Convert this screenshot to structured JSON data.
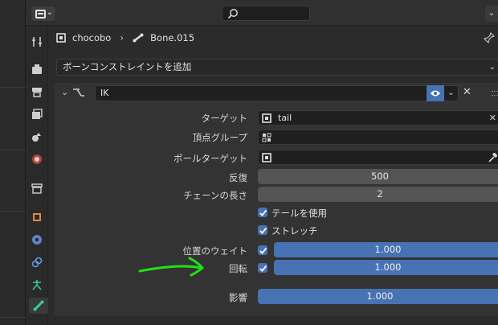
{
  "header": {
    "search_placeholder": "",
    "editor_type_icon": "properties-editor-icon"
  },
  "tabs": [
    {
      "name": "tool-tab",
      "icon": "wrench-screwdriver-icon"
    },
    {
      "name": "render-tab",
      "icon": "camera-back-icon"
    },
    {
      "name": "output-tab",
      "icon": "printer-icon"
    },
    {
      "name": "view-layer-tab",
      "icon": "image-stack-icon"
    },
    {
      "name": "scene-tab",
      "icon": "scene-icon"
    },
    {
      "name": "world-tab",
      "icon": "globe-icon"
    },
    {
      "name": "collection-tab",
      "icon": "box-icon"
    },
    {
      "name": "object-tab",
      "icon": "object-square-icon"
    },
    {
      "name": "modifiers-tab",
      "icon": "physics-icon"
    },
    {
      "name": "object-constraints-tab",
      "icon": "constraint-icon"
    },
    {
      "name": "armature-tab",
      "icon": "armature-figure-icon"
    },
    {
      "name": "bone-constraints-tab",
      "icon": "bone-icon"
    }
  ],
  "breadcrumb": {
    "object": "chocobo",
    "bone": "Bone.015"
  },
  "add_constraint_label": "ボーンコンストレイントを追加",
  "constraint": {
    "name": "IK",
    "target_label": "ターゲット",
    "target_value": "tail",
    "vertex_group_label": "頂点グループ",
    "vertex_group_value": "",
    "pole_target_label": "ポールターゲット",
    "pole_target_value": "",
    "iterations_label": "反復",
    "iterations_value": "500",
    "chain_length_label": "チェーンの長さ",
    "chain_length_value": "2",
    "use_tail_label": "テールを使用",
    "stretch_label": "ストレッチ",
    "position_weight_label": "位置のウェイト",
    "position_weight_value": "1.000",
    "rotation_label": "回転",
    "rotation_value": "1.000",
    "influence_label": "影響",
    "influence_value": "1.000"
  },
  "colors": {
    "accent_blue": "#4772b3",
    "annotation_green": "#22e01a"
  }
}
